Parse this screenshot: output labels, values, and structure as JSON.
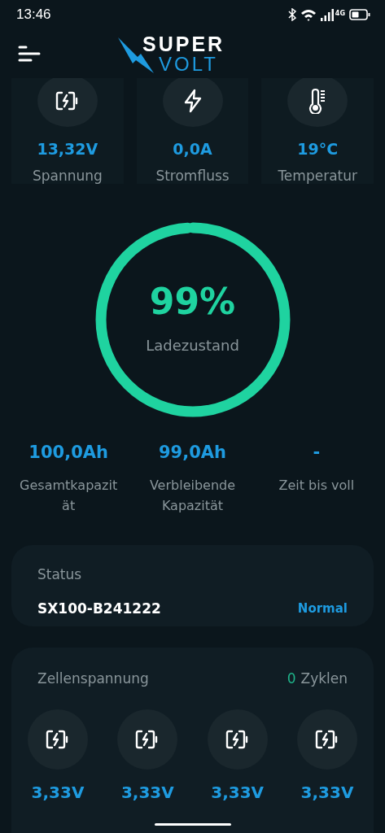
{
  "status_bar": {
    "time": "13:46",
    "network": "4G"
  },
  "header": {
    "logo_top": "SUPER",
    "logo_bottom": "VOLT"
  },
  "metrics": [
    {
      "kind": "voltage",
      "value": "13,32V",
      "label": "Spannung"
    },
    {
      "kind": "current",
      "value": "0,0A",
      "label": "Stromfluss"
    },
    {
      "kind": "temperature",
      "value": "19°C",
      "label": "Temperatur"
    }
  ],
  "charge": {
    "value": "99%",
    "label": "Ladezustand",
    "level": 0.99
  },
  "capacity": [
    {
      "value": "100,0Ah",
      "label": "Gesamtkapazit ät"
    },
    {
      "value": "99,0Ah",
      "label": "Verbleibende Kapazität"
    },
    {
      "value": "-",
      "label": "Zeit bis voll"
    }
  ],
  "status": {
    "title": "Status",
    "device": "SX100-B241222",
    "state": "Normal"
  },
  "cells": {
    "title": "Zellenspannung",
    "cycles_count": "0",
    "cycles_label": "Zyklen",
    "items": [
      {
        "value": "3,33V"
      },
      {
        "value": "3,33V"
      },
      {
        "value": "3,33V"
      },
      {
        "value": "3,33V"
      }
    ]
  }
}
